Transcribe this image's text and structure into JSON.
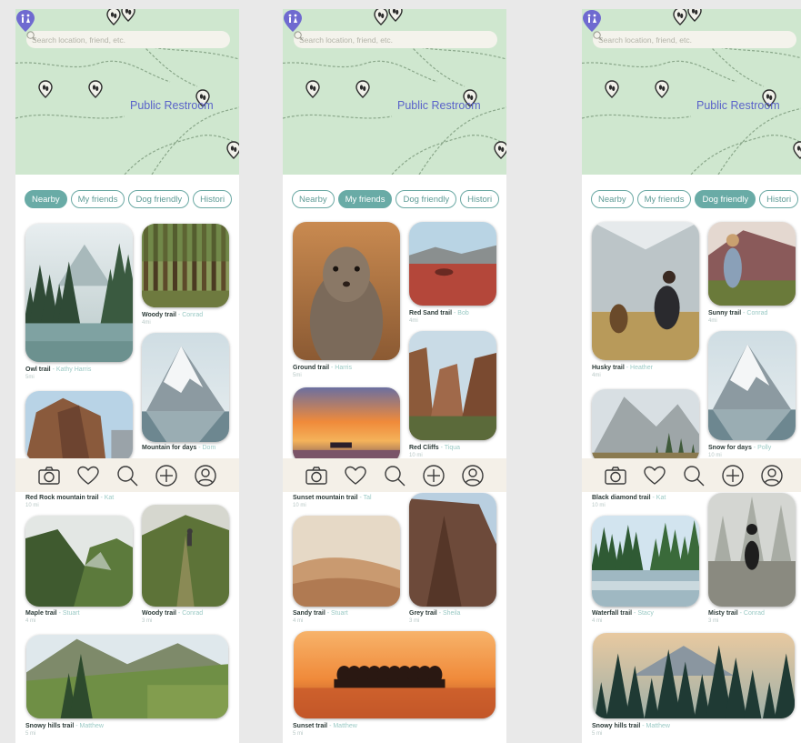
{
  "search_placeholder": "Search location, friend, etc.",
  "map_label": "Public Restroom",
  "chips": [
    "Nearby",
    "My friends",
    "Dog friendly",
    "Histori"
  ],
  "screens": [
    {
      "active_chip": 0,
      "cards": [
        {
          "title": "Owl trail",
          "author": "Kathy Harris",
          "dist": "5mi",
          "theme": "lake"
        },
        {
          "title": "Woody trail",
          "author": "Conrad",
          "dist": "4mi",
          "theme": "forest"
        },
        {
          "title": "Mountain for days",
          "author": "Dom",
          "dist": "",
          "theme": "snowpeak"
        },
        {
          "title": "Red Rock mountain trail",
          "author": "Kat",
          "dist": "10 mi",
          "theme": "redrock"
        },
        {
          "title": "Maple trail",
          "author": "Stuart",
          "dist": "4 mi",
          "theme": "greenvalley"
        },
        {
          "title": "Woody trail",
          "author": "Conrad",
          "dist": "3 mi",
          "theme": "hiker"
        },
        {
          "title": "Snowy hills trail",
          "author": "Matthew",
          "dist": "5 mi",
          "theme": "meadow"
        }
      ]
    },
    {
      "active_chip": 1,
      "cards": [
        {
          "title": "Ground trail",
          "author": "Harris",
          "dist": "5mi",
          "theme": "squirrel"
        },
        {
          "title": "Red Sand trail",
          "author": "Bob",
          "dist": "4mi",
          "theme": "redsand"
        },
        {
          "title": "Red Cliffs",
          "author": "Tiqua",
          "dist": "10 mi",
          "theme": "canyon"
        },
        {
          "title": "Sunset mountain trail",
          "author": "Tal",
          "dist": "10 mi",
          "theme": "sunsetsea"
        },
        {
          "title": "Sandy trail",
          "author": "Stuart",
          "dist": "4 mi",
          "theme": "dunes"
        },
        {
          "title": "Grey trail",
          "author": "Sheila",
          "dist": "3 mi",
          "theme": "cliff"
        },
        {
          "title": "Sunset trail",
          "author": "Matthew",
          "dist": "5 mi",
          "theme": "island"
        }
      ]
    },
    {
      "active_chip": 2,
      "cards": [
        {
          "title": "Husky trail",
          "author": "Heather",
          "dist": "4mi",
          "theme": "husky"
        },
        {
          "title": "Sunny trail",
          "author": "Conrad",
          "dist": "4mi",
          "theme": "dogmtn"
        },
        {
          "title": "Snow for days",
          "author": "Polly",
          "dist": "10 mi",
          "theme": "snowpeak"
        },
        {
          "title": "Black diamond trail",
          "author": "Kat",
          "dist": "10 mi",
          "theme": "greymtn"
        },
        {
          "title": "Waterfall trail",
          "author": "Stacy",
          "dist": "4 mi",
          "theme": "river"
        },
        {
          "title": "Misty trail",
          "author": "Conrad",
          "dist": "3 mi",
          "theme": "mistydog"
        },
        {
          "title": "Snowy hills trail",
          "author": "Matthew",
          "dist": "5 mi",
          "theme": "pines"
        }
      ]
    }
  ],
  "nav_icons": [
    "camera-icon",
    "heart-icon",
    "search-icon",
    "add-icon",
    "profile-icon"
  ],
  "colors": {
    "teal": "#69aba6",
    "map_green": "#cfe7cf",
    "trail_label": "#5a63c9",
    "nav_bg": "#f4f0e8"
  }
}
